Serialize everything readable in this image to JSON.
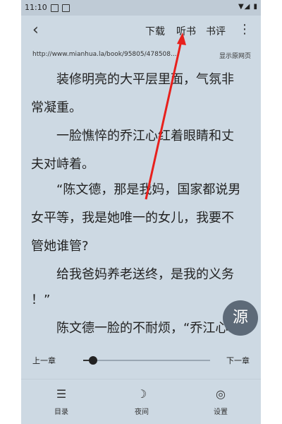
{
  "status": {
    "time": "11:10",
    "right_glyphs": "▼◢ ▮"
  },
  "toolbar": {
    "back_label": "‹",
    "download_label": "下载",
    "listen_label": "听书",
    "review_label": "书评",
    "menu_label": "⋮"
  },
  "urlbar": {
    "url": "http://www.mianhua.la/book/95805/478508...",
    "show_source_label": "显示原网页"
  },
  "content": {
    "lines": [
      "　　装修明亮的大平层里面，气氛非",
      "常凝重。",
      "　　一脸憔悴的乔江心红着眼睛和丈",
      "夫对峙着。",
      "　　“陈文德，那是我妈，国家都说男",
      "女平等，我是她唯一的女儿，我要不",
      "管她谁管?",
      "　　给我爸妈养老送终，是我的义务",
      "！”",
      "　　陈文德一脸的不耐烦，“乔江心"
    ]
  },
  "fab": {
    "label": "源"
  },
  "chapter": {
    "prev_label": "上一章",
    "next_label": "下一章",
    "progress": 0.08
  },
  "bottom_nav": {
    "items": [
      {
        "icon": "☰",
        "label": "目录"
      },
      {
        "icon": "☽",
        "label": "夜间"
      },
      {
        "icon": "◎",
        "label": "设置"
      }
    ]
  },
  "colors": {
    "page_background": "#cdd9e3",
    "status_bar": "#bfcbd6",
    "fab": "#5d6a78",
    "annotation_arrow": "#e8201c"
  }
}
